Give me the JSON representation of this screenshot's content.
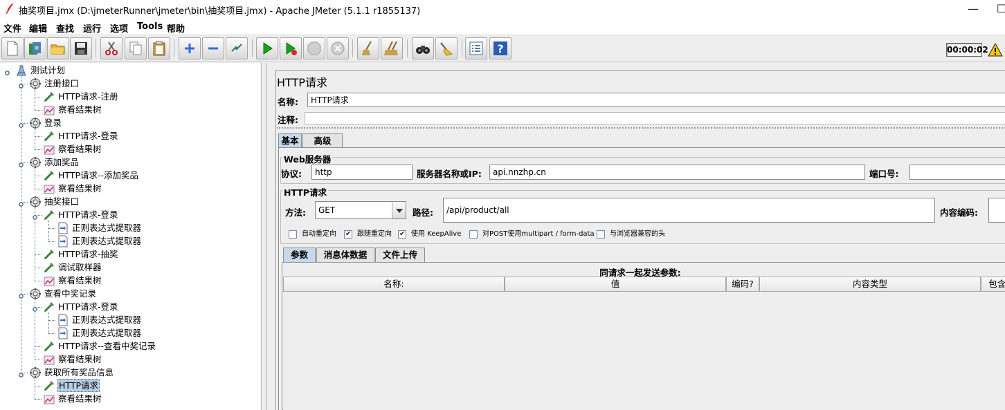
{
  "window": {
    "title": "抽奖项目.jmx (D:\\jmeterRunner\\jmeter\\bin\\抽奖项目.jmx) - Apache JMeter (5.1.1 r1855137)",
    "minimize": "—",
    "maximize": "☐"
  },
  "menu": [
    "文件",
    "编辑",
    "查找",
    "运行",
    "选项",
    "Tools",
    "帮助"
  ],
  "toolbar": {
    "timer": "00:00:02",
    "buttons": [
      "new-icon",
      "templates-icon",
      "open-icon",
      "save-icon",
      "cut-icon",
      "copy-icon",
      "paste-icon",
      "expand-icon",
      "collapse-icon",
      "toggle-icon",
      "start-icon",
      "start-no-pause-icon",
      "stop-icon",
      "shutdown-icon",
      "clear-icon",
      "clear-all-icon",
      "search-icon",
      "reset-search-icon",
      "function-helper-icon",
      "help-icon"
    ]
  },
  "tree": {
    "root": "测试计划",
    "nodes": [
      {
        "label": "注册接口",
        "level": 1,
        "icon": "thread-group-icon"
      },
      {
        "label": "HTTP请求-注册",
        "level": 2,
        "icon": "sampler-icon"
      },
      {
        "label": "察看结果树",
        "level": 2,
        "icon": "listener-icon"
      },
      {
        "label": "登录",
        "level": 1,
        "icon": "thread-group-icon"
      },
      {
        "label": "HTTP请求-登录",
        "level": 2,
        "icon": "sampler-icon"
      },
      {
        "label": "察看结果树",
        "level": 2,
        "icon": "listener-icon"
      },
      {
        "label": "添加奖品",
        "level": 1,
        "icon": "thread-group-icon"
      },
      {
        "label": "HTTP请求--添加奖品",
        "level": 2,
        "icon": "sampler-icon"
      },
      {
        "label": "察看结果树",
        "level": 2,
        "icon": "listener-icon"
      },
      {
        "label": "抽奖接口",
        "level": 1,
        "icon": "thread-group-icon"
      },
      {
        "label": "HTTP请求-登录",
        "level": 2,
        "icon": "sampler-icon"
      },
      {
        "label": "正则表达式提取器",
        "level": 3,
        "icon": "extractor-icon"
      },
      {
        "label": "正则表达式提取器",
        "level": 3,
        "icon": "extractor-icon"
      },
      {
        "label": "HTTP请求-抽奖",
        "level": 2,
        "icon": "sampler-icon"
      },
      {
        "label": "调试取样器",
        "level": 2,
        "icon": "sampler-icon"
      },
      {
        "label": "察看结果树",
        "level": 2,
        "icon": "listener-icon"
      },
      {
        "label": "查看中奖记录",
        "level": 1,
        "icon": "thread-group-icon"
      },
      {
        "label": "HTTP请求-登录",
        "level": 2,
        "icon": "sampler-icon"
      },
      {
        "label": "正则表达式提取器",
        "level": 3,
        "icon": "extractor-icon"
      },
      {
        "label": "正则表达式提取器",
        "level": 3,
        "icon": "extractor-icon"
      },
      {
        "label": "HTTP请求--查看中奖记录",
        "level": 2,
        "icon": "sampler-icon"
      },
      {
        "label": "察看结果树",
        "level": 2,
        "icon": "listener-icon"
      },
      {
        "label": "获取所有奖品信息",
        "level": 1,
        "icon": "thread-group-icon"
      },
      {
        "label": "HTTP请求",
        "level": 2,
        "icon": "sampler-icon",
        "selected": true
      },
      {
        "label": "察看结果树",
        "level": 2,
        "icon": "listener-icon"
      }
    ]
  },
  "panel": {
    "title": "HTTP请求",
    "name_label": "名称:",
    "name_value": "HTTP请求",
    "comment_label": "注释:",
    "comment_value": "",
    "tabs": [
      "基本",
      "高级"
    ],
    "web_server": {
      "group_title": "Web服务器",
      "protocol_label": "协议:",
      "protocol_value": "http",
      "server_label": "服务器名称或IP:",
      "server_value": "api.nnzhp.cn",
      "port_label": "端口号:",
      "port_value": ""
    },
    "http_request": {
      "group_title": "HTTP请求",
      "method_label": "方法:",
      "method_value": "GET",
      "path_label": "路径:",
      "path_value": "/api/product/all",
      "encoding_label": "内容编码:",
      "encoding_value": ""
    },
    "checkboxes": [
      {
        "label": "自动重定向",
        "checked": false
      },
      {
        "label": "跟随重定向",
        "checked": true
      },
      {
        "label": "使用 KeepAlive",
        "checked": true
      },
      {
        "label": "对POST使用multipart / form-data",
        "checked": false
      },
      {
        "label": "与浏览器兼容的头",
        "checked": false
      }
    ],
    "sub_tabs": [
      "参数",
      "消息体数据",
      "文件上传"
    ],
    "params": {
      "caption": "同请求一起发送参数:",
      "columns": [
        "名称:",
        "值",
        "编码?",
        "内容类型",
        "包含等"
      ]
    }
  }
}
